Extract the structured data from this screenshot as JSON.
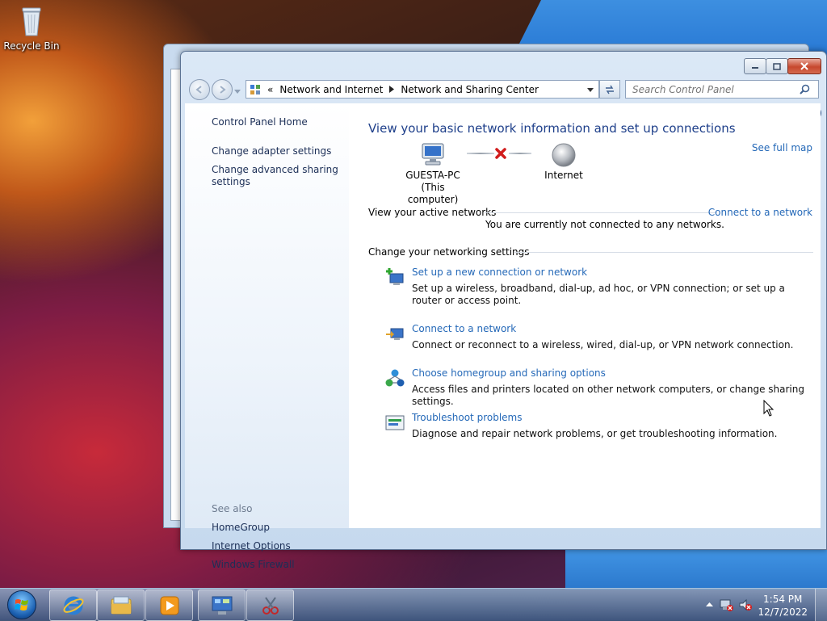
{
  "desktop": {
    "recycle_bin_label": "Recycle Bin"
  },
  "window": {
    "breadcrumb": [
      "Network and Internet",
      "Network and Sharing Center"
    ],
    "search_placeholder": "Search Control Panel"
  },
  "left_pane": {
    "home": "Control Panel Home",
    "links": [
      "Change adapter settings",
      "Change advanced sharing settings"
    ],
    "see_also_heading": "See also",
    "see_also": [
      "HomeGroup",
      "Internet Options",
      "Windows Firewall"
    ]
  },
  "main": {
    "title": "View your basic network information and set up connections",
    "see_full_map": "See full map",
    "computer_name": "GUESTA-PC",
    "computer_sub": "(This computer)",
    "internet_label": "Internet",
    "active_networks_heading": "View your active networks",
    "connect_link": "Connect to a network",
    "not_connected": "You are currently not connected to any networks.",
    "change_settings_heading": "Change your networking settings",
    "tasks": [
      {
        "icon": "new-connection-icon",
        "link": "Set up a new connection or network",
        "desc": "Set up a wireless, broadband, dial-up, ad hoc, or VPN connection; or set up a router or access point."
      },
      {
        "icon": "connect-network-icon",
        "link": "Connect to a network",
        "desc": "Connect or reconnect to a wireless, wired, dial-up, or VPN network connection."
      },
      {
        "icon": "homegroup-icon",
        "link": "Choose homegroup and sharing options",
        "desc": "Access files and printers located on other network computers, or change sharing settings."
      },
      {
        "icon": "troubleshoot-icon",
        "link": "Troubleshoot problems",
        "desc": "Diagnose and repair network problems, or get troubleshooting information."
      }
    ]
  },
  "taskbar": {
    "pinned": [
      "internet-explorer-icon",
      "windows-explorer-icon",
      "media-player-icon",
      "control-panel-icon",
      "snipping-tool-icon"
    ],
    "time": "1:54 PM",
    "date": "12/7/2022"
  },
  "colors": {
    "link": "#2569b8",
    "title": "#1e3f8a",
    "taskbar": "#3c5a82"
  }
}
